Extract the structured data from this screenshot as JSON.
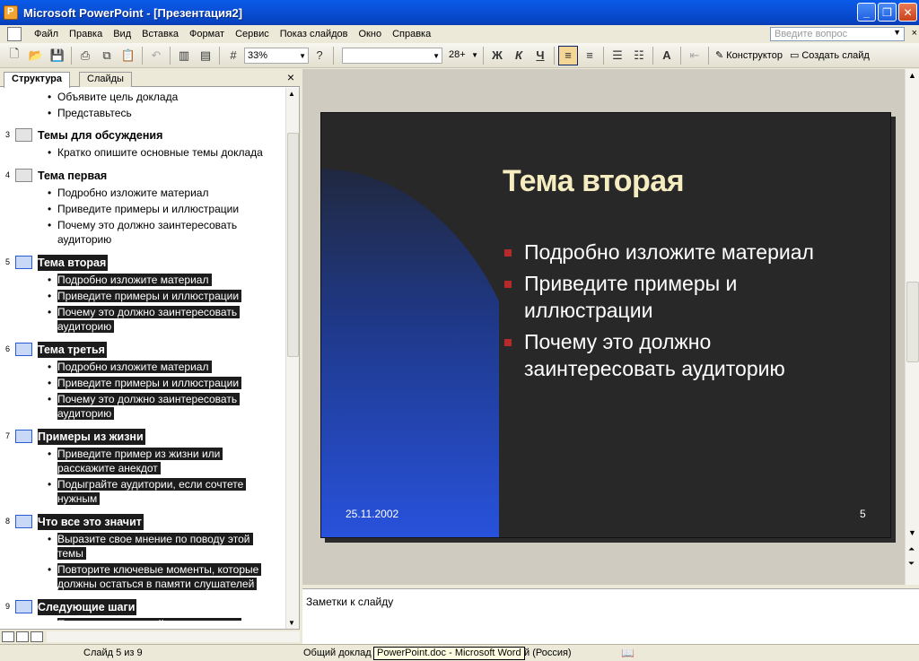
{
  "window": {
    "title": "Microsoft PowerPoint - [Презентация2]",
    "buttons": {
      "minimize": "_",
      "restore": "❐",
      "close": "✕"
    }
  },
  "menu": {
    "items": [
      "Файл",
      "Правка",
      "Вид",
      "Вставка",
      "Формат",
      "Сервис",
      "Показ слайдов",
      "Окно",
      "Справка"
    ],
    "question_placeholder": "Введите вопрос",
    "close": "×"
  },
  "toolbar": {
    "zoom": "33%",
    "font_size": "28+",
    "bold": "Ж",
    "italic": "К",
    "underline": "Ч",
    "designer": "Конструктор",
    "new_slide": "Создать слайд"
  },
  "left_pane": {
    "tabs": [
      "Структура",
      "Слайды"
    ],
    "close": "×"
  },
  "outline": {
    "top_bullets": [
      "Объявите цель доклада",
      "Представьтесь"
    ],
    "slides": [
      {
        "num": "3",
        "title": "Темы для обсуждения",
        "selected": false,
        "bullets": [
          [
            "Кратко опишите основные темы доклада"
          ]
        ]
      },
      {
        "num": "4",
        "title": "Тема первая",
        "selected": false,
        "bullets": [
          [
            "Подробно изложите материал"
          ],
          [
            "Приведите примеры и иллюстрации"
          ],
          [
            "Почему это должно заинтересовать",
            "аудиторию"
          ]
        ]
      },
      {
        "num": "5",
        "title": "Тема вторая",
        "selected": true,
        "bullets": [
          [
            "Подробно изложите материал"
          ],
          [
            "Приведите примеры и иллюстрации"
          ],
          [
            "Почему это должно заинтересовать",
            "аудиторию"
          ]
        ]
      },
      {
        "num": "6",
        "title": "Тема третья",
        "selected": true,
        "bullets": [
          [
            "Подробно изложите материал"
          ],
          [
            "Приведите примеры и иллюстрации"
          ],
          [
            "Почему это должно заинтересовать",
            "аудиторию"
          ]
        ]
      },
      {
        "num": "7",
        "title": "Примеры из жизни",
        "selected": true,
        "bullets": [
          [
            "Приведите пример из жизни или",
            "расскажите анекдот"
          ],
          [
            "Подыграйте аудитории, если сочтете",
            "нужным"
          ]
        ]
      },
      {
        "num": "8",
        "title": "Что все это значит",
        "selected": true,
        "bullets": [
          [
            "Выразите свое мнение по поводу этой",
            "темы"
          ],
          [
            "Повторите ключевые моменты, которые",
            "должны остаться в памяти слушателей"
          ]
        ]
      },
      {
        "num": "9",
        "title": "Следующие шаги",
        "selected": true,
        "bullets": [
          [
            "Перечислите все действия, которые"
          ]
        ]
      }
    ]
  },
  "slide": {
    "title": "Тема вторая",
    "bullets": [
      "Подробно изложите материал",
      "Приведите примеры и иллюстрации",
      "Почему это должно заинтересовать аудиторию"
    ],
    "date": "25.11.2002",
    "number": "5"
  },
  "notes": {
    "placeholder": "Заметки к слайду"
  },
  "status": {
    "slide_of": "Слайд 5 из 9",
    "design": "Общий доклад",
    "tooltip": "PowerPoint.doc - Microsoft Word",
    "language": "й (Россия)"
  },
  "colors": {
    "titlebar": "#0a4fd6",
    "slide_bg": "#282828",
    "slide_title": "#f5ecbf",
    "bullet_marker": "#b52a2a",
    "selection": "#1c1c1c"
  }
}
